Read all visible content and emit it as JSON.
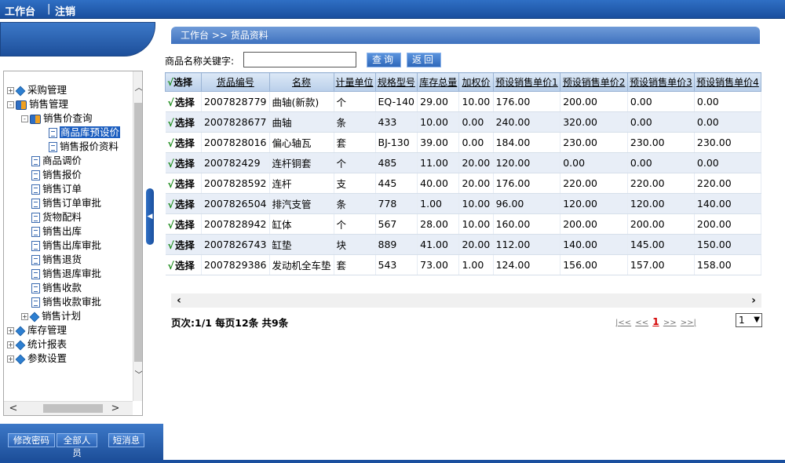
{
  "topbar": {
    "workbench": "工作台",
    "logout": "注销",
    "separator": "|"
  },
  "breadcrumb": "工作台 >> 货品资料",
  "search": {
    "label": "商品名称关键字:",
    "value": "",
    "query_button": "查询",
    "back_button": "返回"
  },
  "sidebar": {
    "items": [
      {
        "label": "采购管理",
        "icon": "diamond-icon",
        "expander": "+"
      },
      {
        "label": "销售管理",
        "icon": "book-icon",
        "expander": "-"
      },
      {
        "label": "销售价查询",
        "icon": "book-icon",
        "expander": "-"
      },
      {
        "label": "商品库预设价",
        "icon": "document-icon",
        "selected": true
      },
      {
        "label": "销售报价资料",
        "icon": "document-icon"
      },
      {
        "label": "商品调价",
        "icon": "document-icon"
      },
      {
        "label": "销售报价",
        "icon": "document-icon"
      },
      {
        "label": "销售订单",
        "icon": "document-icon"
      },
      {
        "label": "销售订单审批",
        "icon": "document-icon"
      },
      {
        "label": "货物配料",
        "icon": "document-icon"
      },
      {
        "label": "销售出库",
        "icon": "document-icon"
      },
      {
        "label": "销售出库审批",
        "icon": "document-icon"
      },
      {
        "label": "销售退货",
        "icon": "document-icon"
      },
      {
        "label": "销售退库审批",
        "icon": "document-icon"
      },
      {
        "label": "销售收款",
        "icon": "document-icon"
      },
      {
        "label": "销售收款审批",
        "icon": "document-icon"
      },
      {
        "label": "销售计划",
        "icon": "diamond-icon",
        "expander": "+"
      },
      {
        "label": "库存管理",
        "icon": "diamond-icon",
        "expander": "+"
      },
      {
        "label": "统计报表",
        "icon": "diamond-icon",
        "expander": "+"
      },
      {
        "label": "参数设置",
        "icon": "diamond-icon",
        "expander": "+"
      }
    ]
  },
  "bottom_buttons": {
    "change_password": "修改密码",
    "all_staff": "全部人员",
    "short_message": "短消息"
  },
  "grid": {
    "columns": [
      "选择",
      "货品编号",
      "名称",
      "计量单位",
      "规格型号",
      "库存总量",
      "加权价",
      "预设销售单价1",
      "预设销售单价2",
      "预设销售单价3",
      "预设销售单价4"
    ],
    "select_label": "选择",
    "rows": [
      [
        "2007828779",
        "曲轴(新款)",
        "个",
        "EQ-140",
        "29.00",
        "10.00",
        "176.00",
        "200.00",
        "0.00",
        "0.00"
      ],
      [
        "2007828677",
        "曲轴",
        "条",
        "433",
        "10.00",
        "0.00",
        "240.00",
        "320.00",
        "0.00",
        "0.00"
      ],
      [
        "2007828016",
        "偏心轴瓦",
        "套",
        "BJ-130",
        "39.00",
        "0.00",
        "184.00",
        "230.00",
        "230.00",
        "230.00"
      ],
      [
        "200782429",
        "连杆铜套",
        "个",
        "485",
        "11.00",
        "20.00",
        "120.00",
        "0.00",
        "0.00",
        "0.00"
      ],
      [
        "2007828592",
        "连杆",
        "支",
        "445",
        "40.00",
        "20.00",
        "176.00",
        "220.00",
        "220.00",
        "220.00"
      ],
      [
        "2007826504",
        "排汽支管",
        "条",
        "778",
        "1.00",
        "10.00",
        "96.00",
        "120.00",
        "120.00",
        "140.00"
      ],
      [
        "2007828942",
        "缸体",
        "个",
        "567",
        "28.00",
        "10.00",
        "160.00",
        "200.00",
        "200.00",
        "200.00"
      ],
      [
        "2007826743",
        "缸垫",
        "块",
        "889",
        "41.00",
        "20.00",
        "112.00",
        "140.00",
        "145.00",
        "150.00"
      ],
      [
        "2007829386",
        "发动机全车垫",
        "套",
        "543",
        "73.00",
        "1.00",
        "124.00",
        "156.00",
        "157.00",
        "158.00"
      ]
    ]
  },
  "pager": {
    "summary": "页次:1/1 每页12条 共9条",
    "first": "|<<",
    "prev": "<<",
    "current": "1",
    "next": ">>",
    "last": ">>|",
    "page_value": "1"
  },
  "colors": {
    "topbar": "#1a4f9e",
    "header_gradient": "#b9cfea",
    "alt_row": "#e8eef7",
    "check": "#1a8a1a",
    "selected_tree": "#1d5fc0"
  }
}
